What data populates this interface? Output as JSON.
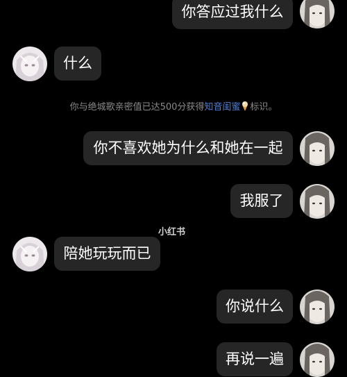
{
  "colors": {
    "background": "#000000",
    "bubble": "#262626",
    "text": "#ffffff",
    "notice_text": "#8a8a8a",
    "highlight": "#4f7fd9"
  },
  "messages": [
    {
      "side": "right",
      "text": "你答应过我什么"
    },
    {
      "side": "left",
      "text": "什么"
    },
    {
      "side": "right",
      "text": "你不喜欢她为什么和她在一起"
    },
    {
      "side": "right",
      "text": "我服了"
    },
    {
      "side": "left",
      "text": "陪她玩玩而已"
    },
    {
      "side": "right",
      "text": "你说什么"
    },
    {
      "side": "right",
      "text": "再说一遍"
    }
  ],
  "system_notice": {
    "prefix": "你与绝城歌亲密值已达500分获得",
    "highlight": "知音闺蜜",
    "icon": "ice-cream-icon",
    "suffix": "标识。"
  },
  "watermark": "小红书"
}
